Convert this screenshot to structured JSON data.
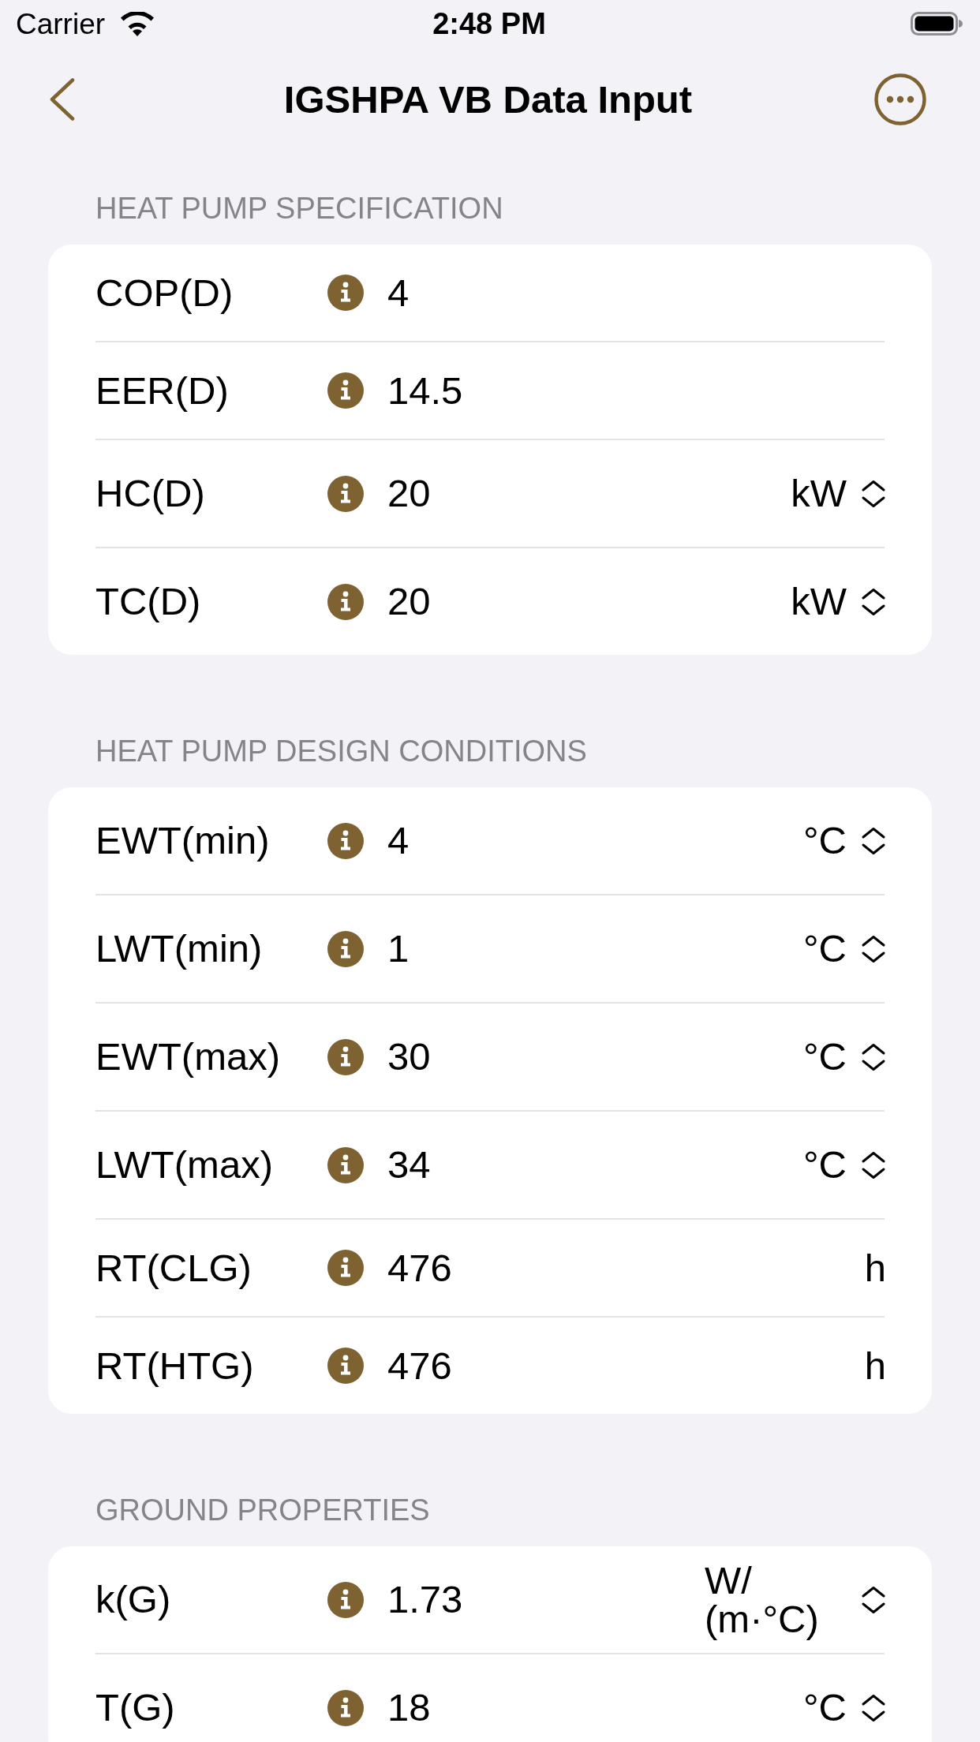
{
  "status_bar": {
    "carrier": "Carrier",
    "time": "2:48 PM"
  },
  "nav_bar": {
    "title": "IGSHPA VB Data Input"
  },
  "sections": [
    {
      "header": "HEAT PUMP SPECIFICATION",
      "rows": [
        {
          "kind": "plain",
          "label": "COP(D)",
          "value": "4"
        },
        {
          "kind": "plain",
          "label": "EER(D)",
          "value": "14.5"
        },
        {
          "kind": "picker",
          "label": "HC(D)",
          "value": "20",
          "unit": "kW"
        },
        {
          "kind": "picker",
          "label": "TC(D)",
          "value": "20",
          "unit": "kW"
        }
      ]
    },
    {
      "header": "HEAT PUMP DESIGN CONDITIONS",
      "rows": [
        {
          "kind": "picker",
          "label": "EWT(min)",
          "value": "4",
          "unit": "°C"
        },
        {
          "kind": "picker",
          "label": "LWT(min)",
          "value": "1",
          "unit": "°C"
        },
        {
          "kind": "picker",
          "label": "EWT(max)",
          "value": "30",
          "unit": "°C"
        },
        {
          "kind": "picker",
          "label": "LWT(max)",
          "value": "34",
          "unit": "°C"
        },
        {
          "kind": "static",
          "label": "RT(CLG)",
          "value": "476",
          "unit": "h"
        },
        {
          "kind": "static",
          "label": "RT(HTG)",
          "value": "476",
          "unit": "h"
        }
      ]
    },
    {
      "header": "GROUND PROPERTIES",
      "rows": [
        {
          "kind": "picker",
          "label": "k(G)",
          "value": "1.73",
          "unit": "W/ (m·°C)"
        },
        {
          "kind": "picker",
          "label": "T(G)",
          "value": "18",
          "unit": "°C"
        }
      ]
    }
  ]
}
